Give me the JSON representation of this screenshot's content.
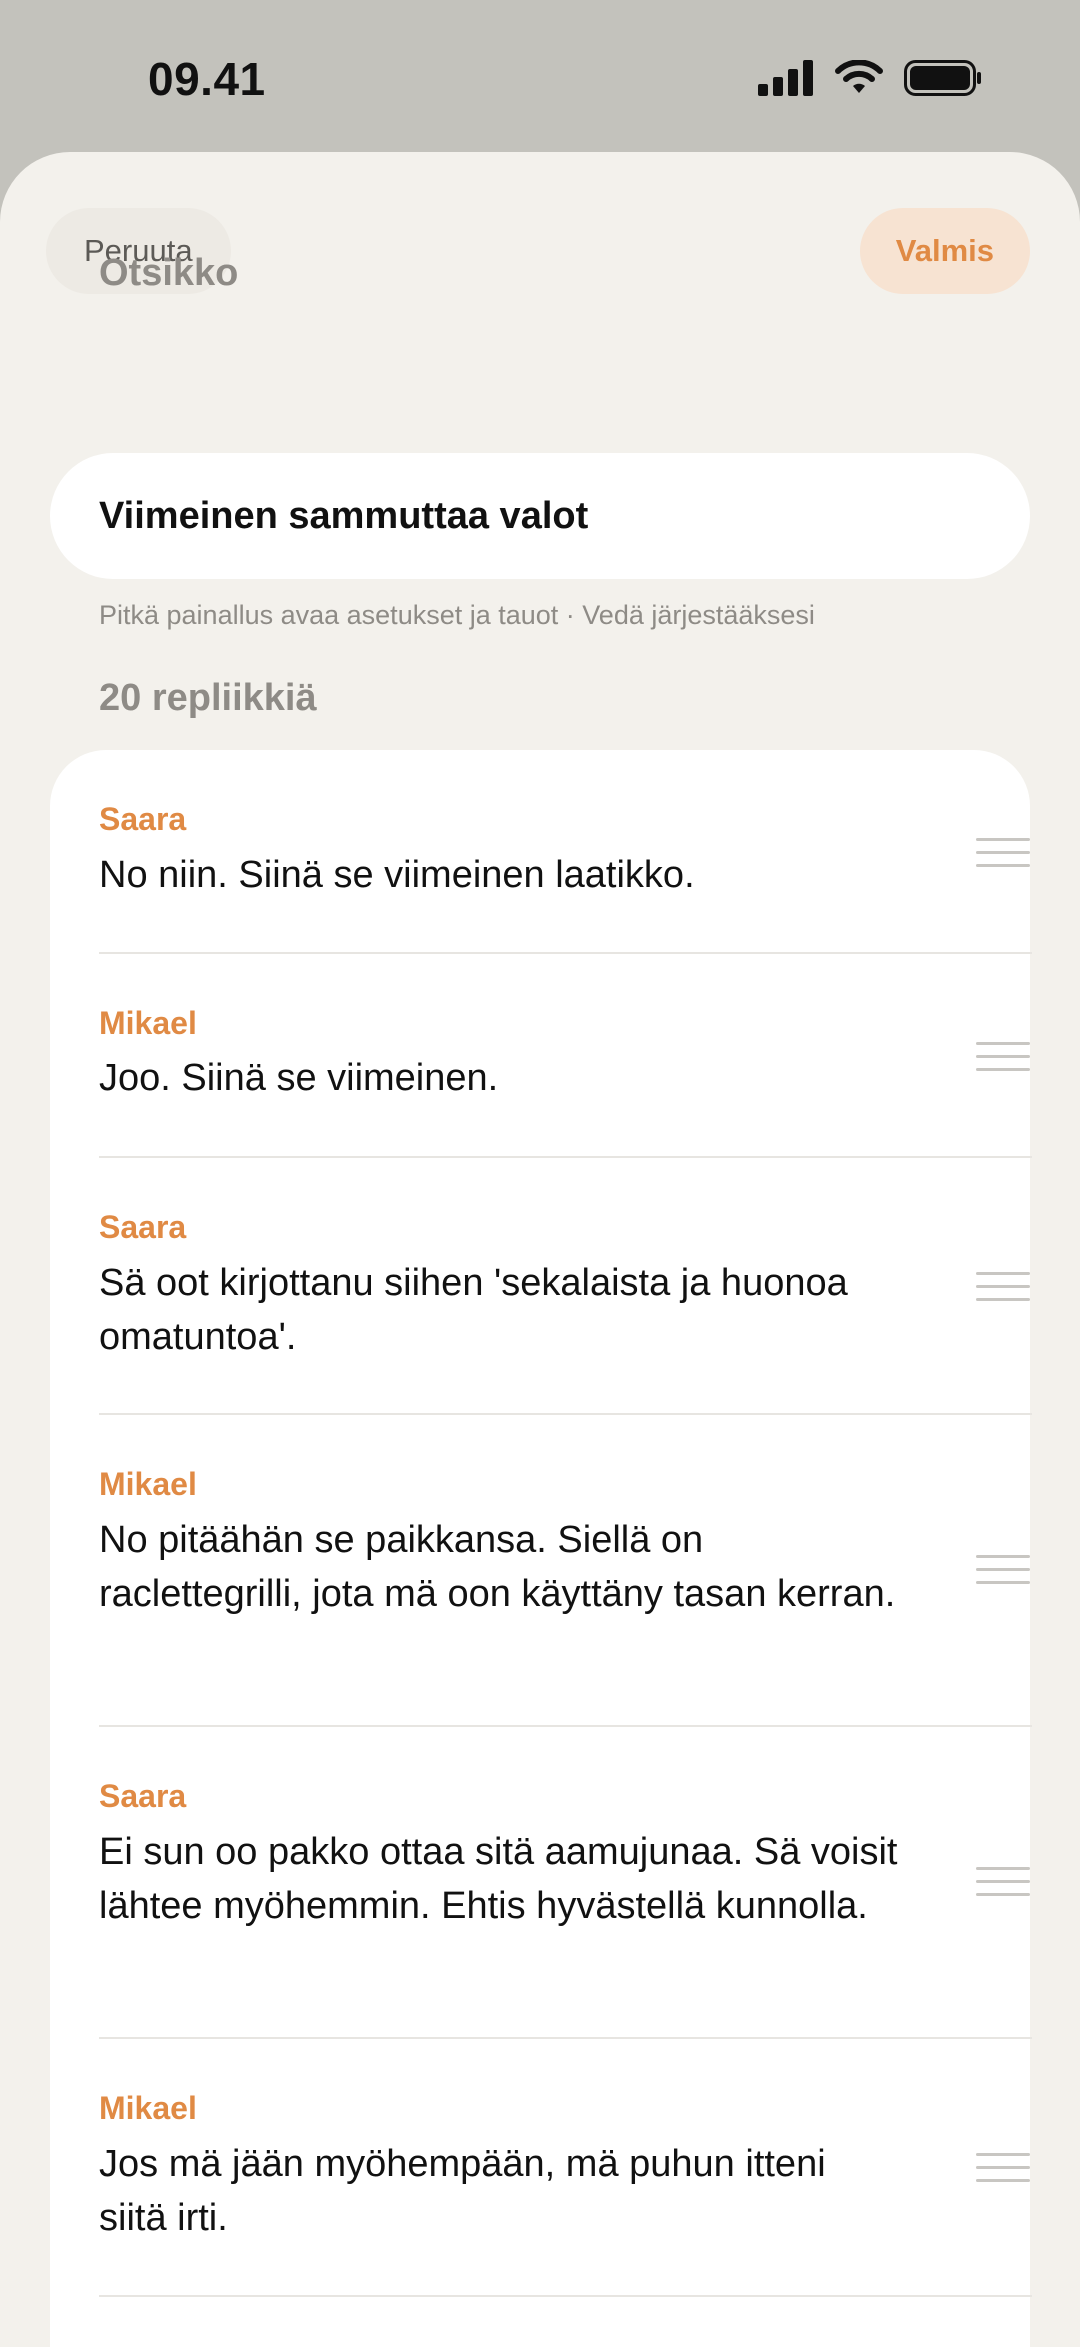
{
  "status_bar": {
    "time": "09.41"
  },
  "toolbar": {
    "cancel_label": "Peruuta",
    "done_label": "Valmis"
  },
  "title_section": {
    "label": "Otsikko",
    "value": "Viimeinen sammuttaa valot"
  },
  "hint": "Pitkä painallus avaa asetukset ja tauot · Vedä järjestääksesi",
  "lines_section": {
    "count_label": "20 repliikkiä",
    "items": [
      {
        "speaker": "Saara",
        "text": "No niin. Siinä se viimeinen laatikko."
      },
      {
        "speaker": "Mikael",
        "text": "Joo. Siinä se viimeinen."
      },
      {
        "speaker": "Saara",
        "text": "Sä oot kirjottanu siihen 'sekalaista ja huonoa omatuntoa'."
      },
      {
        "speaker": "Mikael",
        "text": "No pitäähän se paikkansa. Siellä on raclettegrilli, jota mä oon käyttäny tasan kerran."
      },
      {
        "speaker": "Saara",
        "text": "Ei sun oo pakko ottaa sitä aamujunaa. Sä voisit lähtee myöhemmin. Ehtis hyvästellä kunnolla."
      },
      {
        "speaker": "Mikael",
        "text": "Jos mä jään myöhempään, mä puhun itteni siitä irti."
      }
    ]
  },
  "colors": {
    "accent": "#e08a44",
    "sheet_bg": "#f3f1ec",
    "status_bg": "#c3c2bc"
  }
}
